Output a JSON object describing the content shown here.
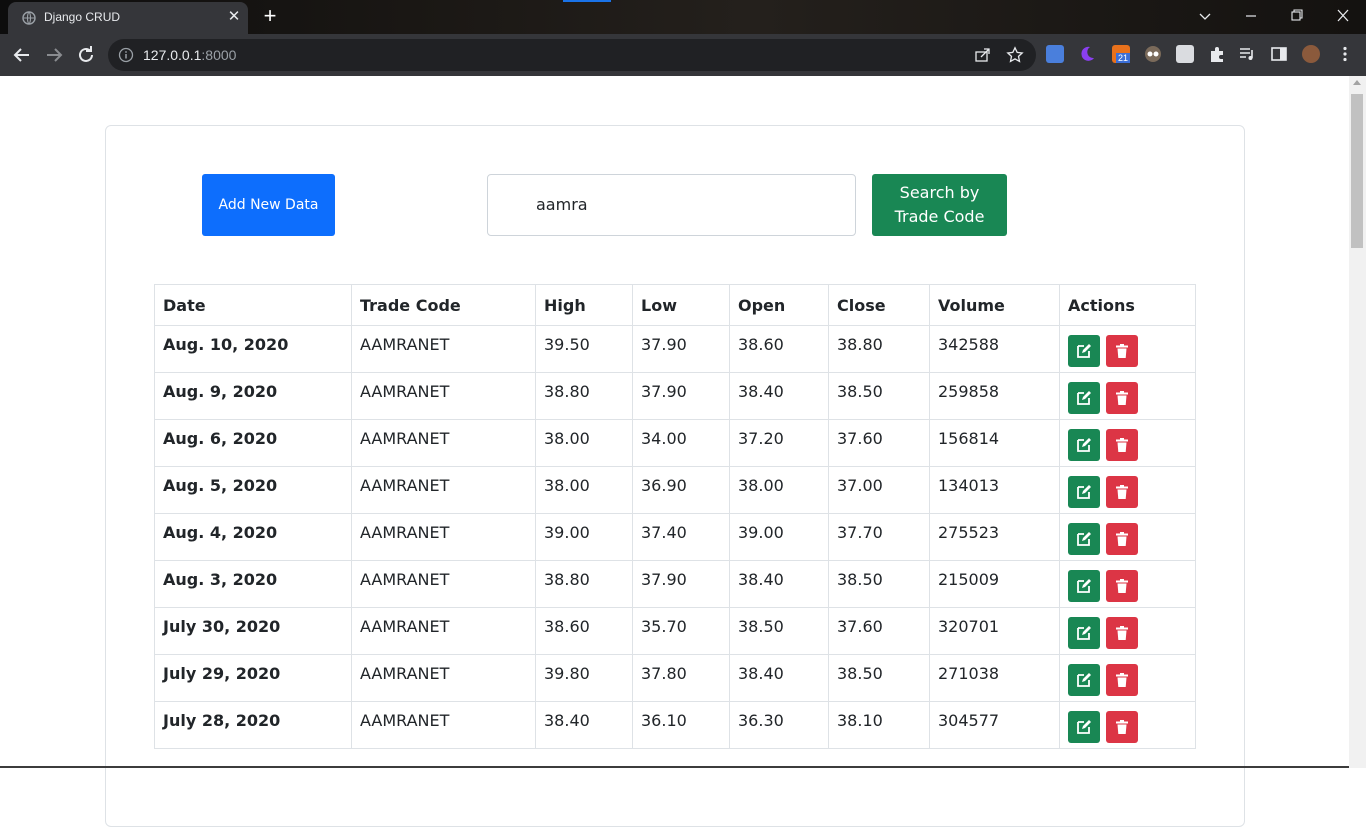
{
  "browser": {
    "tab_title": "Django CRUD",
    "url_host": "127.0.0.1",
    "url_port": ":8000",
    "extension_badge": "21"
  },
  "page": {
    "add_button_label": "Add New Data",
    "search_value": "aamra",
    "search_button_line1": "Search by",
    "search_button_line2": "Trade Code"
  },
  "table": {
    "headers": [
      "Date",
      "Trade Code",
      "High",
      "Low",
      "Open",
      "Close",
      "Volume",
      "Actions"
    ],
    "rows": [
      {
        "date": "Aug. 10, 2020",
        "trade_code": "AAMRANET",
        "high": "39.50",
        "low": "37.90",
        "open": "38.60",
        "close": "38.80",
        "volume": "342588"
      },
      {
        "date": "Aug. 9, 2020",
        "trade_code": "AAMRANET",
        "high": "38.80",
        "low": "37.90",
        "open": "38.40",
        "close": "38.50",
        "volume": "259858"
      },
      {
        "date": "Aug. 6, 2020",
        "trade_code": "AAMRANET",
        "high": "38.00",
        "low": "34.00",
        "open": "37.20",
        "close": "37.60",
        "volume": "156814"
      },
      {
        "date": "Aug. 5, 2020",
        "trade_code": "AAMRANET",
        "high": "38.00",
        "low": "36.90",
        "open": "38.00",
        "close": "37.00",
        "volume": "134013"
      },
      {
        "date": "Aug. 4, 2020",
        "trade_code": "AAMRANET",
        "high": "39.00",
        "low": "37.40",
        "open": "39.00",
        "close": "37.70",
        "volume": "275523"
      },
      {
        "date": "Aug. 3, 2020",
        "trade_code": "AAMRANET",
        "high": "38.80",
        "low": "37.90",
        "open": "38.40",
        "close": "38.50",
        "volume": "215009"
      },
      {
        "date": "July 30, 2020",
        "trade_code": "AAMRANET",
        "high": "38.60",
        "low": "35.70",
        "open": "38.50",
        "close": "37.60",
        "volume": "320701"
      },
      {
        "date": "July 29, 2020",
        "trade_code": "AAMRANET",
        "high": "39.80",
        "low": "37.80",
        "open": "38.40",
        "close": "38.50",
        "volume": "271038"
      },
      {
        "date": "July 28, 2020",
        "trade_code": "AAMRANET",
        "high": "38.40",
        "low": "36.10",
        "open": "36.30",
        "close": "38.10",
        "volume": "304577"
      }
    ]
  },
  "colors": {
    "primary": "#0d6efd",
    "success": "#198754",
    "danger": "#dc3545",
    "border": "#dee2e6"
  },
  "icons": {
    "edit": "edit-icon",
    "delete": "trash-icon"
  }
}
